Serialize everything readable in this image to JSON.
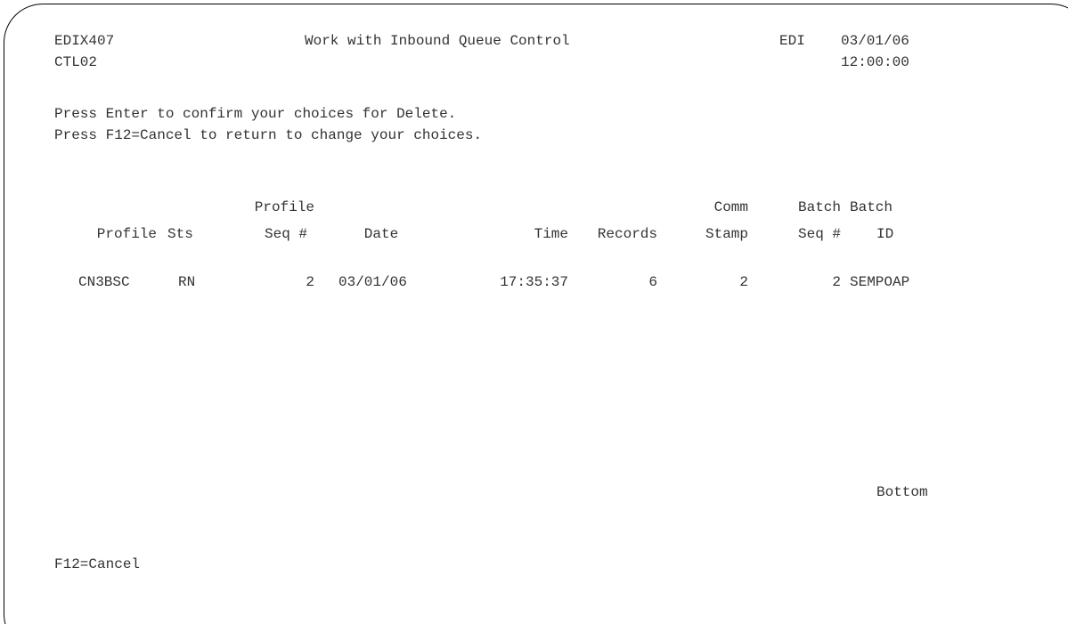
{
  "header": {
    "program_id": "EDIX407",
    "title": "Work with Inbound Queue Control",
    "system": "EDI",
    "date": "03/01/06",
    "format_id": "CTL02",
    "time": "12:00:00"
  },
  "instructions": {
    "line1": "Press Enter to confirm your choices for Delete.",
    "line2": "Press F12=Cancel to return to change your choices."
  },
  "table": {
    "columns": {
      "profile": {
        "top": "",
        "bottom": "Profile"
      },
      "sts": {
        "top": "",
        "bottom": "Sts"
      },
      "profile_seq": {
        "top": "Profile",
        "bottom": "Seq #"
      },
      "date": {
        "top": "",
        "bottom": "Date"
      },
      "time": {
        "top": "",
        "bottom": "Time"
      },
      "records": {
        "top": "",
        "bottom": "Records"
      },
      "comm_stamp": {
        "top": "Comm",
        "bottom": "Stamp"
      },
      "batch_seq": {
        "top": "Batch",
        "bottom": "Seq #"
      },
      "batch_id": {
        "top": "Batch",
        "bottom": "ID"
      }
    },
    "rows": [
      {
        "profile": "CN3BSC",
        "sts": "RN",
        "profile_seq": "2",
        "date": "03/01/06",
        "time": "17:35:37",
        "records": "6",
        "comm_stamp": "2",
        "batch_seq": "2",
        "batch_id": "SEMPOAP"
      }
    ]
  },
  "scroll_indicator": "Bottom",
  "function_keys": {
    "f12": "F12=Cancel"
  }
}
